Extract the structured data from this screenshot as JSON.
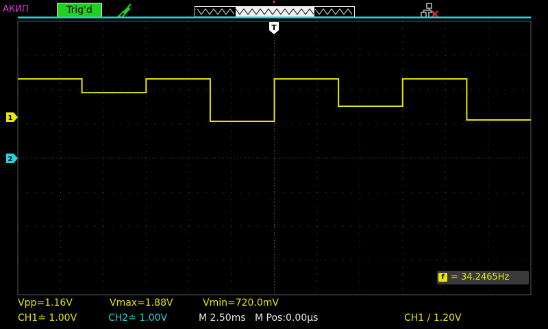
{
  "header": {
    "brand": "АКИП",
    "trigger_status": "Trig'd"
  },
  "channel_markers": {
    "ch1": "1",
    "ch2": "2",
    "trigger": "T"
  },
  "frequency": {
    "badge": "f",
    "text": "= 34.2465Hz"
  },
  "measurements": {
    "vpp": "Vpp=1.16V",
    "vmax": "Vmax=1.88V",
    "vmin": "Vmin=720.0mV"
  },
  "bottom": {
    "ch1_scale": "CH1≐ 1.00V",
    "ch2_scale": "CH2≐ 1.00V",
    "timebase": "M 2.50ms",
    "mpos": "M Pos:0.00µs",
    "trigger_info": "CH1 ∕ 1.20V"
  },
  "colors": {
    "ch1": "#e8e800",
    "ch2": "#20d8e0",
    "grid": "#5a5a5a",
    "trig_status_bg": "#22d020",
    "brand": "#e040d0"
  },
  "icons": {
    "probe": "probe-icon",
    "usb": "usb-icon",
    "memory": "memory-depth-icon"
  },
  "traces": {
    "ch1_levels_div": [
      1.12,
      0.72,
      1.12,
      -0.12,
      1.12,
      0.32,
      1.12,
      -0.08
    ],
    "ch2_level_div": 4.0
  }
}
